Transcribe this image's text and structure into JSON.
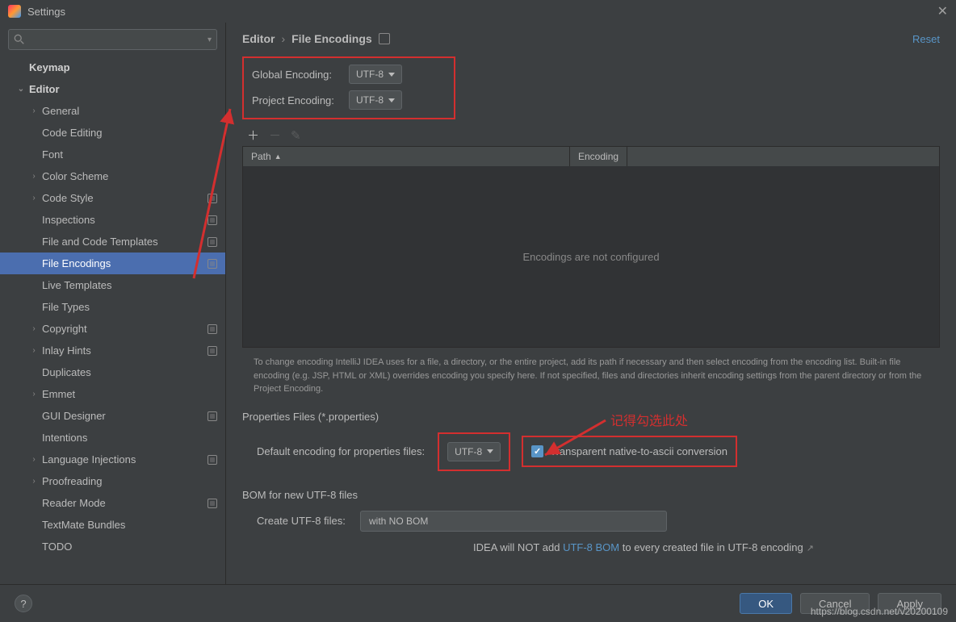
{
  "titlebar": {
    "title": "Settings"
  },
  "search": {
    "placeholder": ""
  },
  "sidebar": {
    "items": [
      {
        "label": "Keymap",
        "level": 1,
        "chev": false
      },
      {
        "label": "Editor",
        "level": 1,
        "chev": true,
        "open": true
      },
      {
        "label": "General",
        "level": 2,
        "chev": true
      },
      {
        "label": "Code Editing",
        "level": 2,
        "chev": false
      },
      {
        "label": "Font",
        "level": 2,
        "chev": false
      },
      {
        "label": "Color Scheme",
        "level": 2,
        "chev": true
      },
      {
        "label": "Code Style",
        "level": 2,
        "chev": true,
        "proj": true
      },
      {
        "label": "Inspections",
        "level": 2,
        "chev": false,
        "proj": true
      },
      {
        "label": "File and Code Templates",
        "level": 2,
        "chev": false,
        "proj": true
      },
      {
        "label": "File Encodings",
        "level": 2,
        "chev": false,
        "proj": true,
        "selected": true
      },
      {
        "label": "Live Templates",
        "level": 2,
        "chev": false
      },
      {
        "label": "File Types",
        "level": 2,
        "chev": false
      },
      {
        "label": "Copyright",
        "level": 2,
        "chev": true,
        "proj": true
      },
      {
        "label": "Inlay Hints",
        "level": 2,
        "chev": true,
        "proj": true
      },
      {
        "label": "Duplicates",
        "level": 2,
        "chev": false
      },
      {
        "label": "Emmet",
        "level": 2,
        "chev": true
      },
      {
        "label": "GUI Designer",
        "level": 2,
        "chev": false,
        "proj": true
      },
      {
        "label": "Intentions",
        "level": 2,
        "chev": false
      },
      {
        "label": "Language Injections",
        "level": 2,
        "chev": true,
        "proj": true
      },
      {
        "label": "Proofreading",
        "level": 2,
        "chev": true
      },
      {
        "label": "Reader Mode",
        "level": 2,
        "chev": false,
        "proj": true
      },
      {
        "label": "TextMate Bundles",
        "level": 2,
        "chev": false
      },
      {
        "label": "TODO",
        "level": 2,
        "chev": false
      }
    ]
  },
  "breadcrumb": {
    "root": "Editor",
    "page": "File Encodings",
    "reset": "Reset"
  },
  "global_encoding": {
    "label": "Global Encoding:",
    "value": "UTF-8"
  },
  "project_encoding": {
    "label": "Project Encoding:",
    "value": "UTF-8"
  },
  "table": {
    "col1": "Path",
    "col2": "Encoding",
    "empty": "Encodings are not configured"
  },
  "help": "To change encoding IntelliJ IDEA uses for a file, a directory, or the entire project, add its path if necessary and then select encoding from the encoding list. Built-in file encoding (e.g. JSP, HTML or XML) overrides encoding you specify here. If not specified, files and directories inherit encoding settings from the parent directory or from the Project Encoding.",
  "props": {
    "section": "Properties Files (*.properties)",
    "label": "Default encoding for properties files:",
    "value": "UTF-8",
    "checkbox_label": "Transparent native-to-ascii conversion"
  },
  "bom": {
    "section": "BOM for new UTF-8 files",
    "label": "Create UTF-8 files:",
    "value": "with NO BOM",
    "note_pre": "IDEA will NOT add ",
    "note_link": "UTF-8 BOM",
    "note_post": " to every created file in UTF-8 encoding"
  },
  "buttons": {
    "ok": "OK",
    "cancel": "Cancel",
    "apply": "Apply"
  },
  "annotation": "记得勾选此处",
  "watermark": "https://blog.csdn.net/v20200109"
}
